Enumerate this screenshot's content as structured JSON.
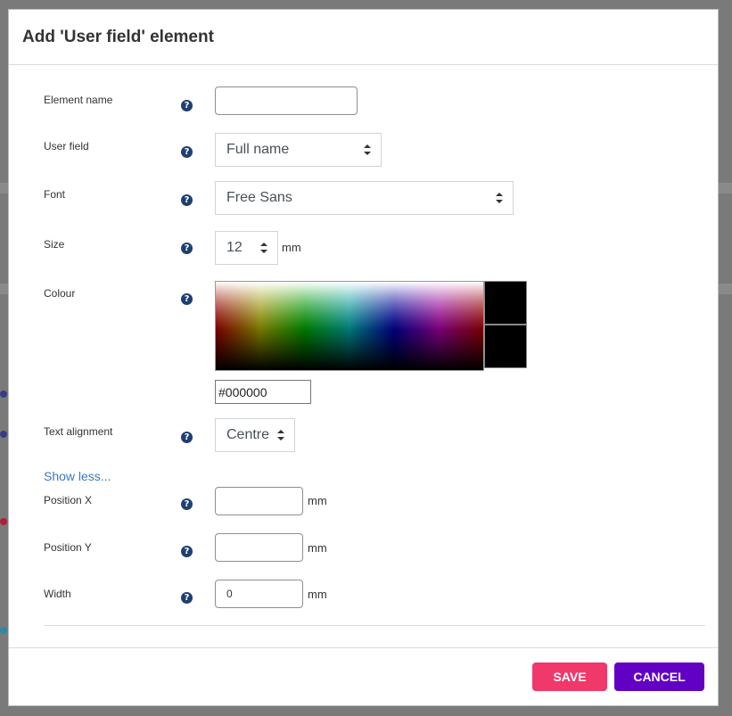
{
  "modal": {
    "title": "Add 'User field' element",
    "help_glyph": "?"
  },
  "form": {
    "element_name": {
      "label": "Element name",
      "value": "",
      "placeholder": ""
    },
    "user_field": {
      "label": "User field",
      "selected": "Full name"
    },
    "font": {
      "label": "Font",
      "selected": "Free Sans"
    },
    "size": {
      "label": "Size",
      "selected": "12",
      "unit": "mm"
    },
    "colour": {
      "label": "Colour",
      "hex_value": "#000000",
      "selected_colour": "#000000"
    },
    "text_alignment": {
      "label": "Text alignment",
      "selected": "Centre"
    },
    "show_less_link": "Show less...",
    "position_x": {
      "label": "Position X",
      "value": "",
      "unit": "mm"
    },
    "position_y": {
      "label": "Position Y",
      "value": "",
      "unit": "mm"
    },
    "width": {
      "label": "Width",
      "value": "0",
      "unit": "mm"
    }
  },
  "footer": {
    "save_label": "SAVE",
    "cancel_label": "CANCEL"
  },
  "colors": {
    "save_button": "#f0386b",
    "cancel_button": "#6200c4",
    "link": "#3a78c3",
    "help_icon": "#1d3f72"
  },
  "icons": {
    "help": "question-circle-icon",
    "select_caret": "sort-caret-icon"
  }
}
